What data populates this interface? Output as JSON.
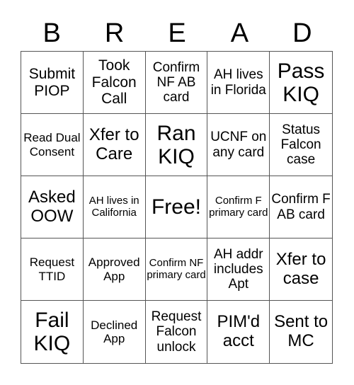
{
  "header": [
    "B",
    "R",
    "E",
    "A",
    "D"
  ],
  "cells": [
    {
      "text": "Submit PIOP",
      "size": "s20"
    },
    {
      "text": "Took Falcon Call",
      "size": "s20"
    },
    {
      "text": "Confirm NF AB card",
      "size": "s18"
    },
    {
      "text": "AH lives in Florida",
      "size": "s18"
    },
    {
      "text": "Pass KIQ",
      "size": "s28"
    },
    {
      "text": "Read Dual Consent",
      "size": "s16"
    },
    {
      "text": "Xfer to Care",
      "size": "s22"
    },
    {
      "text": "Ran KIQ",
      "size": "s28"
    },
    {
      "text": "UCNF on any card",
      "size": "s18"
    },
    {
      "text": "Status Falcon case",
      "size": "s18"
    },
    {
      "text": "Asked OOW",
      "size": "s22"
    },
    {
      "text": "AH lives in California",
      "size": "s14"
    },
    {
      "text": "Free!",
      "size": "s28"
    },
    {
      "text": "Confirm F primary card",
      "size": "s14"
    },
    {
      "text": "Confirm F AB card",
      "size": "s18"
    },
    {
      "text": "Request TTID",
      "size": "s16"
    },
    {
      "text": "Approved App",
      "size": "s16"
    },
    {
      "text": "Confirm NF primary card",
      "size": "s14"
    },
    {
      "text": "AH addr includes Apt",
      "size": "s18"
    },
    {
      "text": "Xfer to case",
      "size": "s22"
    },
    {
      "text": "Fail KIQ",
      "size": "s28"
    },
    {
      "text": "Declined App",
      "size": "s16"
    },
    {
      "text": "Request Falcon unlock",
      "size": "s18"
    },
    {
      "text": "PIM'd acct",
      "size": "s22"
    },
    {
      "text": "Sent to MC",
      "size": "s22"
    }
  ]
}
